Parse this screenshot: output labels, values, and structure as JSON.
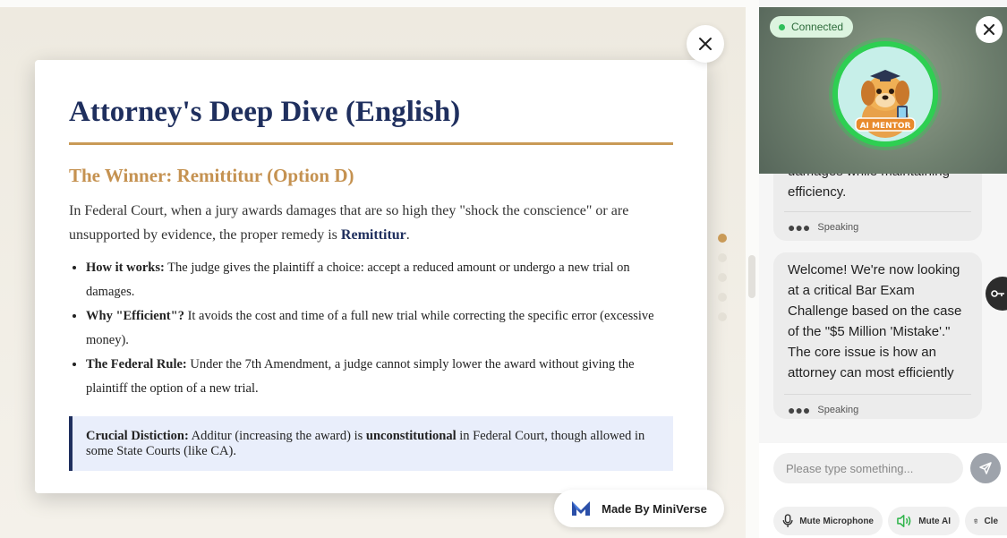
{
  "card": {
    "title": "Attorney's Deep Dive (English)",
    "subtitle": "The Winner: Remittitur (Option D)",
    "intro_before": "In Federal Court, when a jury awards damages that are so high they \"shock the conscience\" or are unsupported by evidence, the proper remedy is ",
    "intro_bold": "Remittitur",
    "intro_after": ".",
    "points": [
      {
        "label": "How it works:",
        "text": " The judge gives the plaintiff a choice: accept a reduced amount or undergo a new trial on damages."
      },
      {
        "label": "Why \"Efficient\"?",
        "text": " It avoids the cost and time of a full new trial while correcting the specific error (excessive money)."
      },
      {
        "label": "The Federal Rule:",
        "text": " Under the 7th Amendment, a judge cannot simply lower the award without giving the plaintiff the option of a new trial."
      }
    ],
    "callout": {
      "label": "Crucial Distiction:",
      "text_before": " Additur (increasing the award) is ",
      "bold": "unconstitutional",
      "text_after": " in Federal Court, though allowed in some State Courts (like CA)."
    }
  },
  "made_by": "Made By MiniVerse",
  "panel": {
    "status": "Connected",
    "avatar_label": "AI MENTOR",
    "messages": [
      {
        "text": "damages while maintaining efficiency.",
        "status": "Speaking"
      },
      {
        "text": "Welcome! We're now looking at a critical Bar Exam Challenge based on the case of the \"$5 Million 'Mistake'.\" The core issue is how an attorney can most efficiently",
        "status": "Speaking"
      }
    ],
    "input_placeholder": "Please type something...",
    "controls": {
      "mute_mic": "Mute Microphone",
      "mute_ai": "Mute AI",
      "clear": "Cle"
    }
  },
  "colors": {
    "title": "#1f2f5e",
    "accent": "#c99a57",
    "connected": "#2fbf5a"
  }
}
